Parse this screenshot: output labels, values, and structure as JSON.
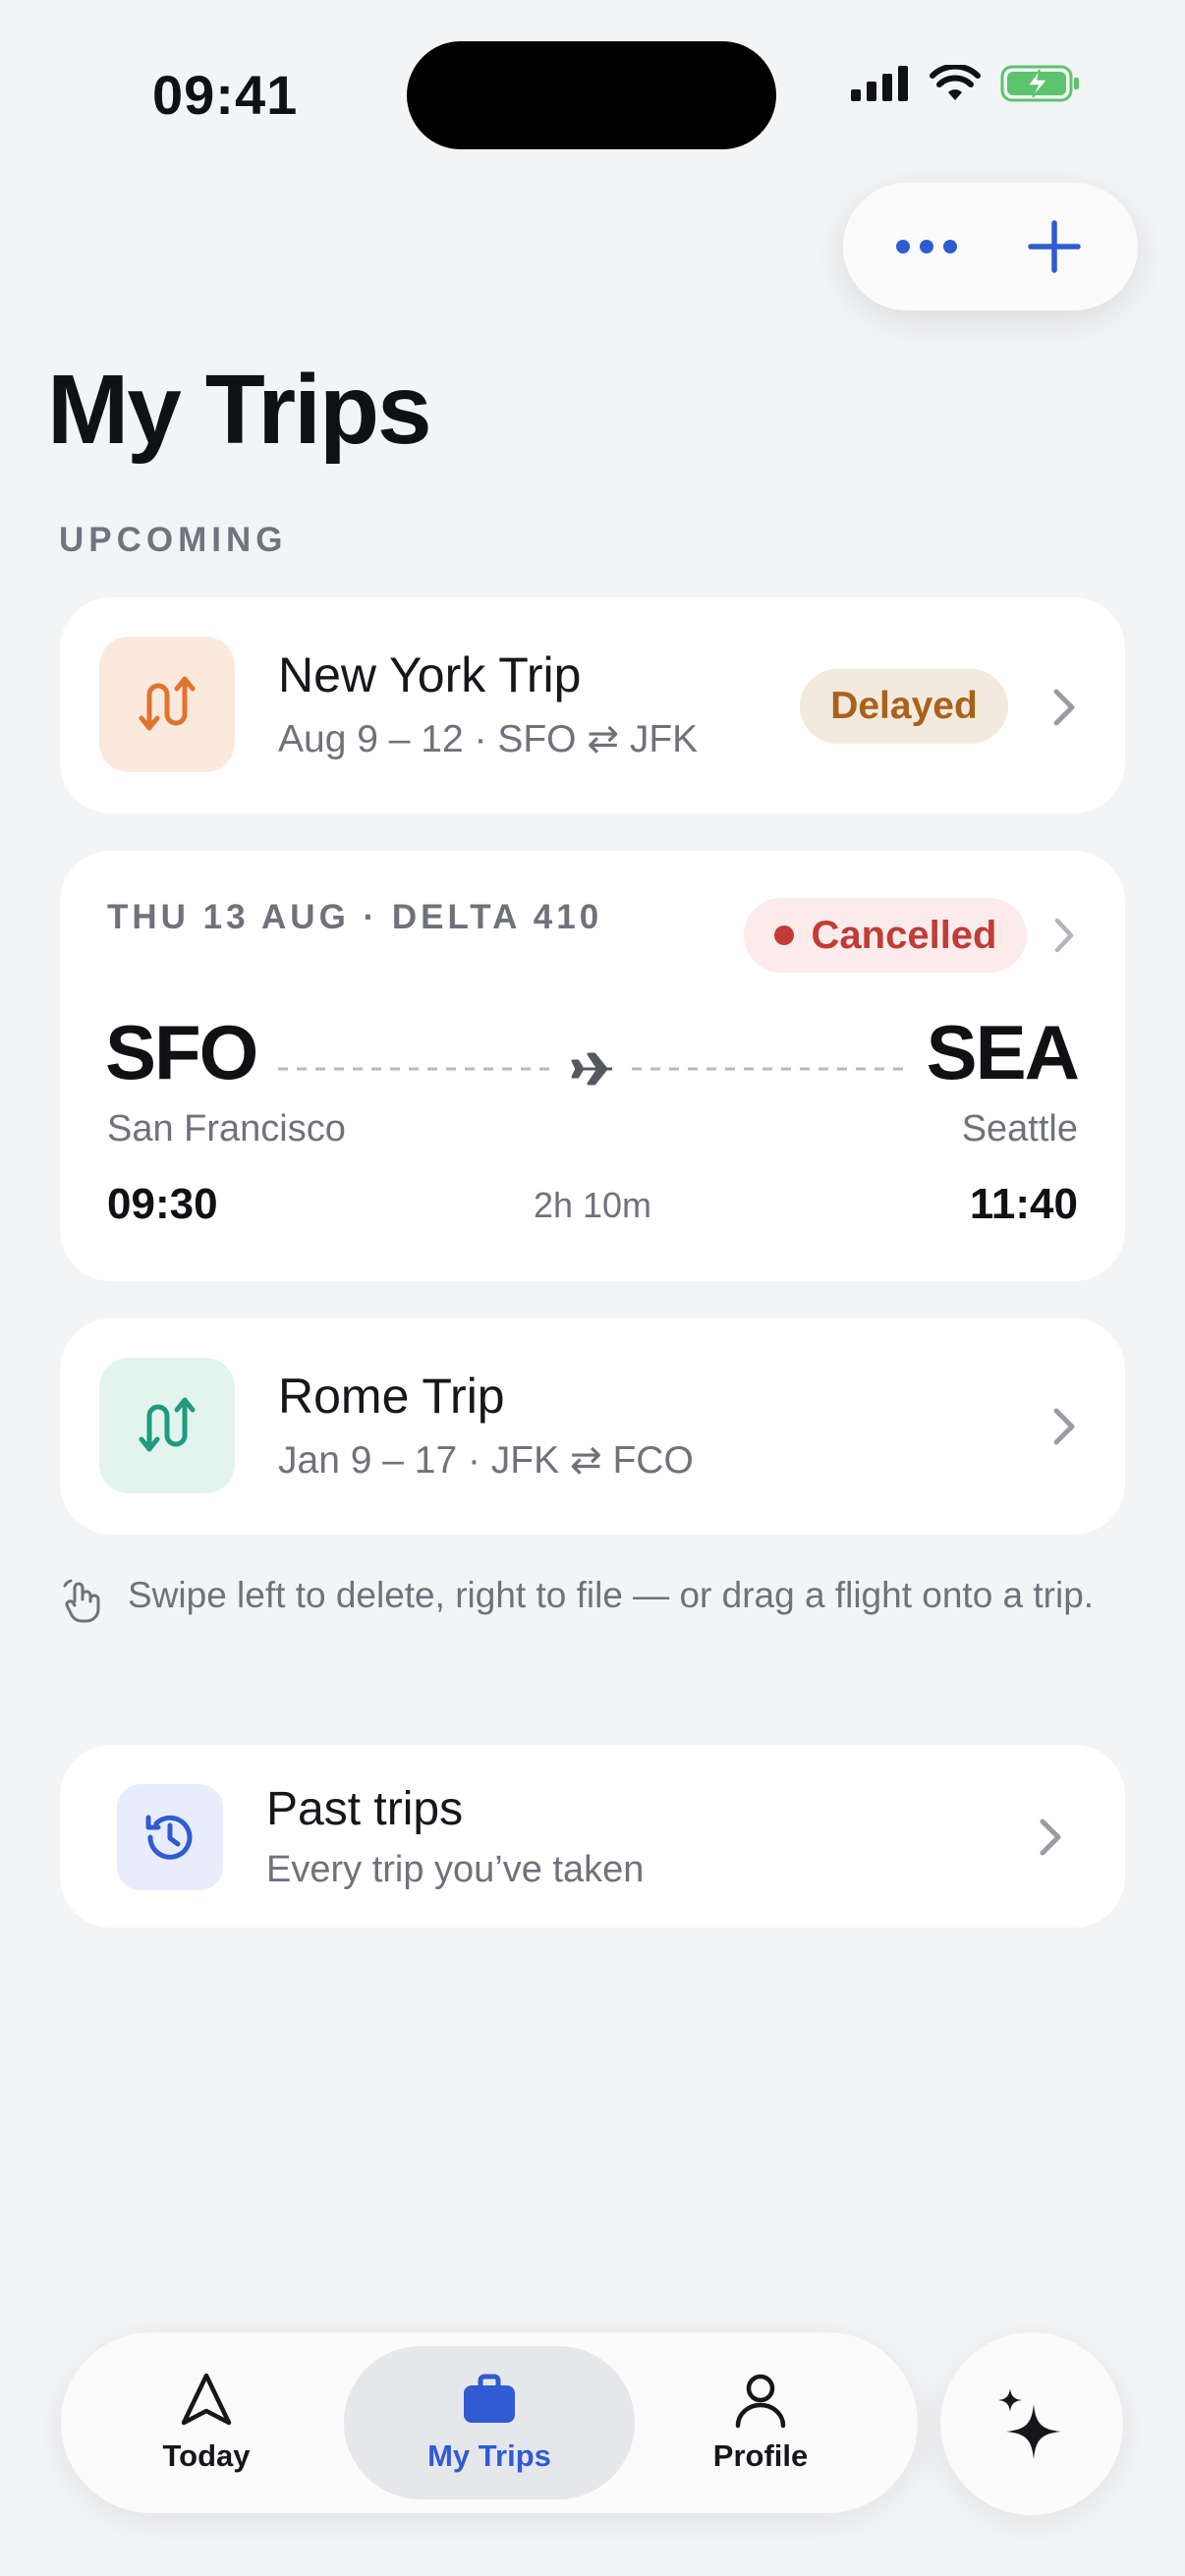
{
  "status_bar": {
    "time": "09:41"
  },
  "header": {
    "title": "My Trips",
    "more_icon": "ellipsis-icon",
    "add_icon": "plus-icon",
    "accent": "#2f5bd3"
  },
  "section": {
    "label": "UPCOMING"
  },
  "trips": [
    {
      "name": "New York Trip",
      "subtitle": "Aug 9 – 12 · SFO ⇄ JFK",
      "badge": "Delayed",
      "badge_color": "#a8621a",
      "icon_bg": "#fbe9de",
      "icon_color": "#e0742a"
    },
    {
      "name": "Rome Trip",
      "subtitle": "Jan 9 – 17 · JFK ⇄ FCO",
      "icon_bg": "#e3f3ee",
      "icon_color": "#1f9a80"
    }
  ],
  "flight": {
    "meta": "THU 13 AUG · DELTA 410",
    "status": "Cancelled",
    "status_color": "#c23b35",
    "origin_code": "SFO",
    "origin_city": "San Francisco",
    "dest_code": "SEA",
    "dest_city": "Seattle",
    "depart_time": "09:30",
    "arrive_time": "11:40",
    "duration": "2h 10m"
  },
  "hint": {
    "text": "Swipe left to delete, right to file — or drag a flight onto a trip."
  },
  "past": {
    "title": "Past trips",
    "subtitle": "Every trip you’ve taken"
  },
  "tabbar": {
    "tabs": [
      {
        "label": "Today",
        "icon": "navigation-arrow-icon"
      },
      {
        "label": "My Trips",
        "icon": "briefcase-icon",
        "active": true
      },
      {
        "label": "Profile",
        "icon": "person-icon"
      }
    ],
    "ai_icon": "sparkles-icon"
  }
}
